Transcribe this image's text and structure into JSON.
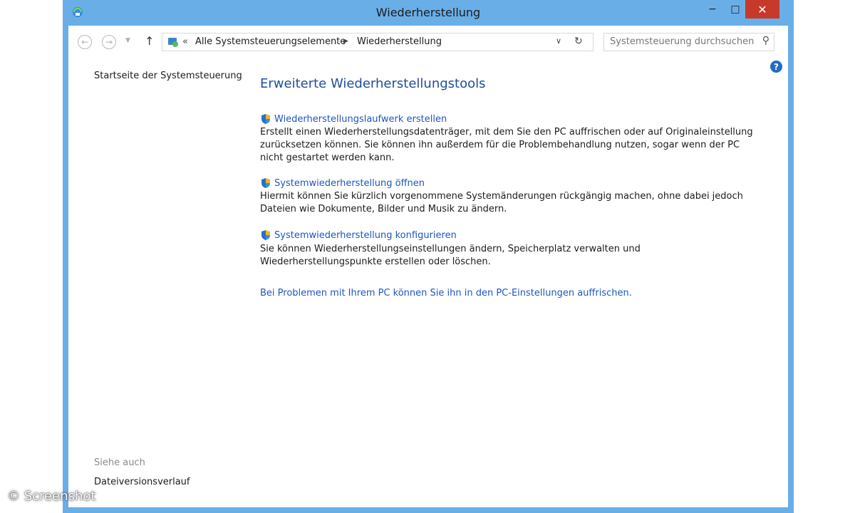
{
  "window": {
    "title": "Wiederherstellung",
    "controls": {
      "minimize": "−",
      "maximize": "□",
      "close": "✕"
    }
  },
  "navbar": {
    "back": "←",
    "forward": "→",
    "up": "↑",
    "breadcrumb_prefix": "«",
    "breadcrumb": [
      "Alle Systemsteuerungselemente",
      "Wiederherstellung"
    ],
    "search_placeholder": "Systemsteuerung durchsuchen"
  },
  "sidebar": {
    "home": "Startseite der Systemsteuerung",
    "see_also": "Siehe auch",
    "links": [
      "Dateiversionsverlauf"
    ]
  },
  "main": {
    "heading": "Erweiterte Wiederherstellungstools",
    "tasks": [
      {
        "title": "Wiederherstellungslaufwerk erstellen",
        "description": "Erstellt einen Wiederherstellungsdatenträger, mit dem Sie den PC auffrischen oder auf Originaleinstellung zurücksetzen können. Sie können ihn außerdem für die Problembehandlung nutzen, sogar wenn der PC nicht gestartet werden kann."
      },
      {
        "title": "Systemwiederherstellung öffnen",
        "description": "Hiermit können Sie kürzlich vorgenommene Systemänderungen rückgängig machen, ohne dabei jedoch Dateien wie Dokumente, Bilder und Musik zu ändern."
      },
      {
        "title": "Systemwiederherstellung konfigurieren",
        "description": "Sie können Wiederherstellungseinstellungen ändern, Speicherplatz verwalten und Wiederherstellungspunkte erstellen oder löschen."
      }
    ],
    "refresh_link": "Bei Problemen mit Ihrem PC können Sie ihn in den PC-Einstellungen auffrischen."
  },
  "watermark": "© Screenshot",
  "colors": {
    "frame": "#6aaee8",
    "link": "#1e56c2",
    "heading": "#1e4e9a",
    "close": "#c7392b"
  }
}
